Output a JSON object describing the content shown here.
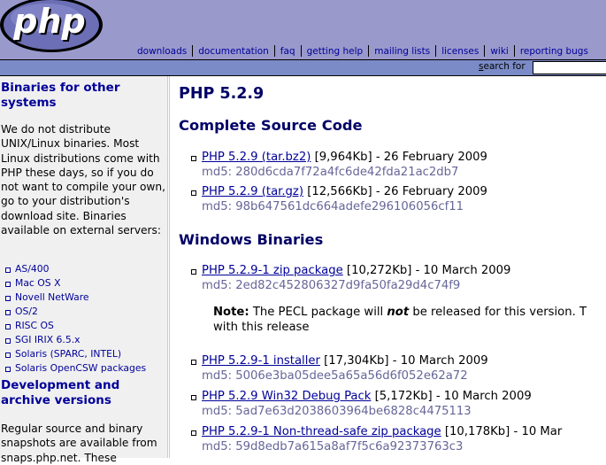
{
  "header": {
    "logo_text": "php",
    "nav": [
      "downloads",
      "documentation",
      "faq",
      "getting help",
      "mailing lists",
      "licenses",
      "wiki",
      "reporting bugs"
    ],
    "search_label_prefix": "s",
    "search_label_rest": "earch for"
  },
  "sidebar": {
    "h1": "Binaries for other systems",
    "p1": "We do not distribute UNIX/Linux binaries. Most Linux distributions come with PHP these days, so if you do not want to compile your own, go to your distribution's download site. Binaries available on external servers:",
    "systems": [
      "AS/400",
      "Mac OS X",
      "Novell NetWare",
      "OS/2",
      "RISC OS",
      "SGI IRIX 6.5.x",
      "Solaris (SPARC, INTEL)",
      "Solaris OpenCSW packages"
    ],
    "h2": "Development and archive versions",
    "p2": "Regular source and binary snapshots are available from snaps.php.net. These"
  },
  "content": {
    "release_title": "PHP 5.2.9",
    "source_title": "Complete Source Code",
    "source": [
      {
        "link": "PHP 5.2.9 (tar.bz2)",
        "info": " [9,964Kb] - 26 February 2009",
        "md5": "md5: 280d6cda7f72a4fc6de42fda21ac2db7"
      },
      {
        "link": "PHP 5.2.9 (tar.gz)",
        "info": " [12,566Kb] - 26 February 2009",
        "md5": "md5: 98b647561dc664adefe296106056cf11"
      }
    ],
    "windows_title": "Windows Binaries",
    "win_zip": {
      "link": "PHP 5.2.9-1 zip package",
      "info": " [10,272Kb] - 10 March 2009",
      "md5": "md5: 2ed82c452806327d9fa50fa29d4c74f9"
    },
    "note": {
      "label": "Note:",
      "text1": " The PECL package will ",
      "emph": "not",
      "text2": " be released for this version. T",
      "line2": "with this release"
    },
    "windows": [
      {
        "link": "PHP 5.2.9-1 installer",
        "info": " [17,304Kb] - 10 March 2009",
        "md5": "md5: 5006e3ba05dee5a65a56d6f052e62a72"
      },
      {
        "link": "PHP 5.2.9 Win32 Debug Pack",
        "info": " [5,172Kb] - 10 March 2009",
        "md5": "md5: 5ad7e63d2038603964be6828c4475113"
      },
      {
        "link": "PHP 5.2.9-1 Non-thread-safe zip package",
        "info": " [10,178Kb] - 10 Mar",
        "md5": "md5: 59d8edb7a615a8af7f5c6a92373763c3"
      }
    ]
  }
}
